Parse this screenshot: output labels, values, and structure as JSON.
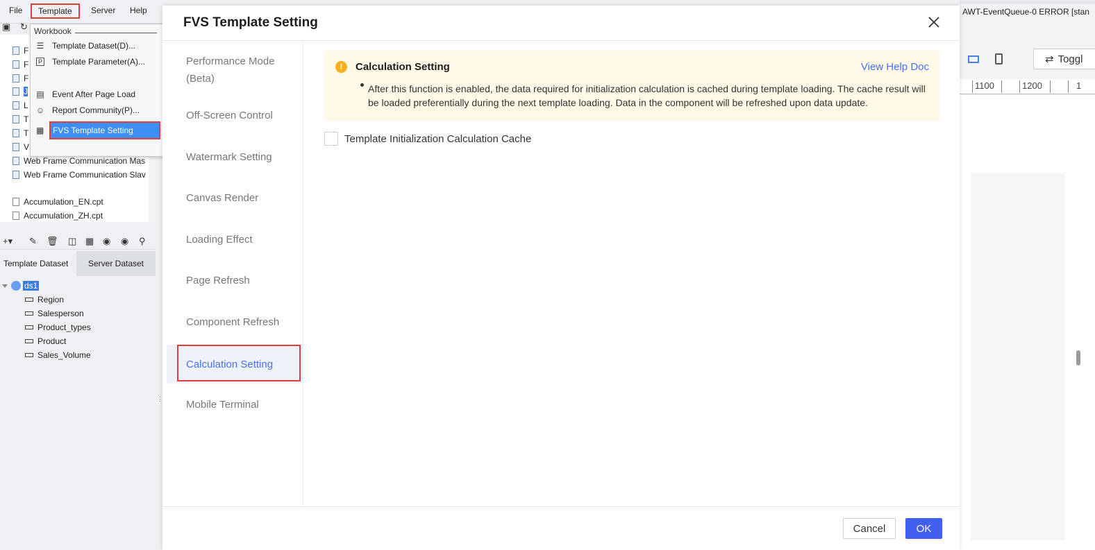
{
  "menubar": {
    "items": [
      "File",
      "Template",
      "Server",
      "Help"
    ]
  },
  "tree": {
    "items": [
      {
        "label": "F"
      },
      {
        "label": "F"
      },
      {
        "label": "F"
      },
      {
        "label": "J"
      },
      {
        "label": "L"
      },
      {
        "label": "T"
      },
      {
        "label": "T"
      },
      {
        "label": "V"
      },
      {
        "label": "Web Frame Communication Mas"
      },
      {
        "label": "Web Frame Communication Slav"
      },
      {
        "label": "Accumulation_EN.cpt"
      },
      {
        "label": "Accumulation_ZH.cpt"
      }
    ]
  },
  "dataset_tabs": {
    "template_dataset": "Template Dataset",
    "server_dataset": "Server Dataset"
  },
  "dataset_tree": {
    "root": "ds1",
    "fields": [
      "Region",
      "Salesperson",
      "Product_types",
      "Product",
      "Sales_Volume"
    ]
  },
  "template_menu": {
    "group_label": "Workbook",
    "items": [
      {
        "label": "Template Dataset(D)...",
        "icon": "database-icon"
      },
      {
        "label": "Template Parameter(A)...",
        "icon": "parameter-icon"
      },
      {
        "label": "Event After Page Load",
        "icon": "event-icon"
      },
      {
        "label": "Report Community(P)...",
        "icon": "community-icon"
      },
      {
        "label": "FVS Template Setting",
        "icon": "fvs-setting-icon"
      }
    ]
  },
  "right_panel": {
    "console_text": "AWT-EventQueue-0 ERROR [stan",
    "toggle_label": "Toggl",
    "ruler_ticks": [
      "1100",
      "1200",
      "1"
    ]
  },
  "modal": {
    "title": "FVS Template Setting",
    "nav": [
      "Performance Mode (Beta)",
      "Off-Screen Control",
      "Watermark Setting",
      "Canvas Render",
      "Loading Effect",
      "Page Refresh",
      "Component Refresh",
      "Calculation Setting",
      "Mobile Terminal"
    ],
    "active_nav": "Calculation Setting",
    "notice": {
      "title": "Calculation Setting",
      "help_link": "View Help Doc",
      "body": "After this function is enabled, the data required for initialization calculation is cached during template loading. The cache result will be loaded preferentially during the next template loading. Data in the component will be refreshed upon data update."
    },
    "checkbox_label": "Template Initialization Calculation Cache",
    "checkbox_checked": false,
    "cancel_label": "Cancel",
    "ok_label": "OK"
  },
  "colors": {
    "accent": "#4260f0",
    "highlight_border": "#e23d3d",
    "notice_bg": "#fef9e6",
    "warning": "#f5b01a"
  }
}
